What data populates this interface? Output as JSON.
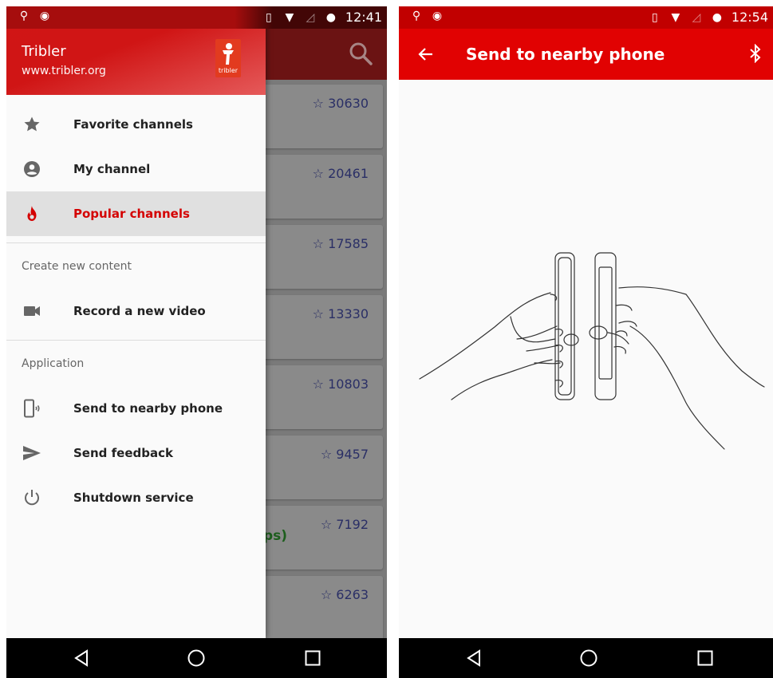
{
  "left": {
    "status": {
      "time": "12:41"
    },
    "background_counts": [
      "☆ 30630",
      "☆ 20461",
      "☆ 17585",
      "☆ 13330",
      "☆ 10803",
      "☆ 9457",
      "☆ 7192",
      "☆ 6263"
    ],
    "background_peek": "ps)",
    "drawer": {
      "title": "Tribler",
      "subtitle": "www.tribler.org",
      "logo_word": "tribler",
      "items": [
        {
          "label": "Favorite channels",
          "icon": "star-icon"
        },
        {
          "label": "My channel",
          "icon": "account-icon"
        },
        {
          "label": "Popular channels",
          "icon": "flame-icon",
          "active": true
        }
      ],
      "section_create": "Create new content",
      "create_items": [
        {
          "label": "Record a new video",
          "icon": "videocam-icon"
        }
      ],
      "section_app": "Application",
      "app_items": [
        {
          "label": "Send to nearby phone",
          "icon": "phone-beam-icon"
        },
        {
          "label": "Send feedback",
          "icon": "send-icon"
        },
        {
          "label": "Shutdown service",
          "icon": "power-icon"
        }
      ]
    }
  },
  "right": {
    "status": {
      "time": "12:54"
    },
    "appbar": {
      "title": "Send to nearby phone"
    }
  },
  "colors": {
    "primary": "#e10202",
    "active_text": "#d40000",
    "count_text": "#2a2f66"
  }
}
